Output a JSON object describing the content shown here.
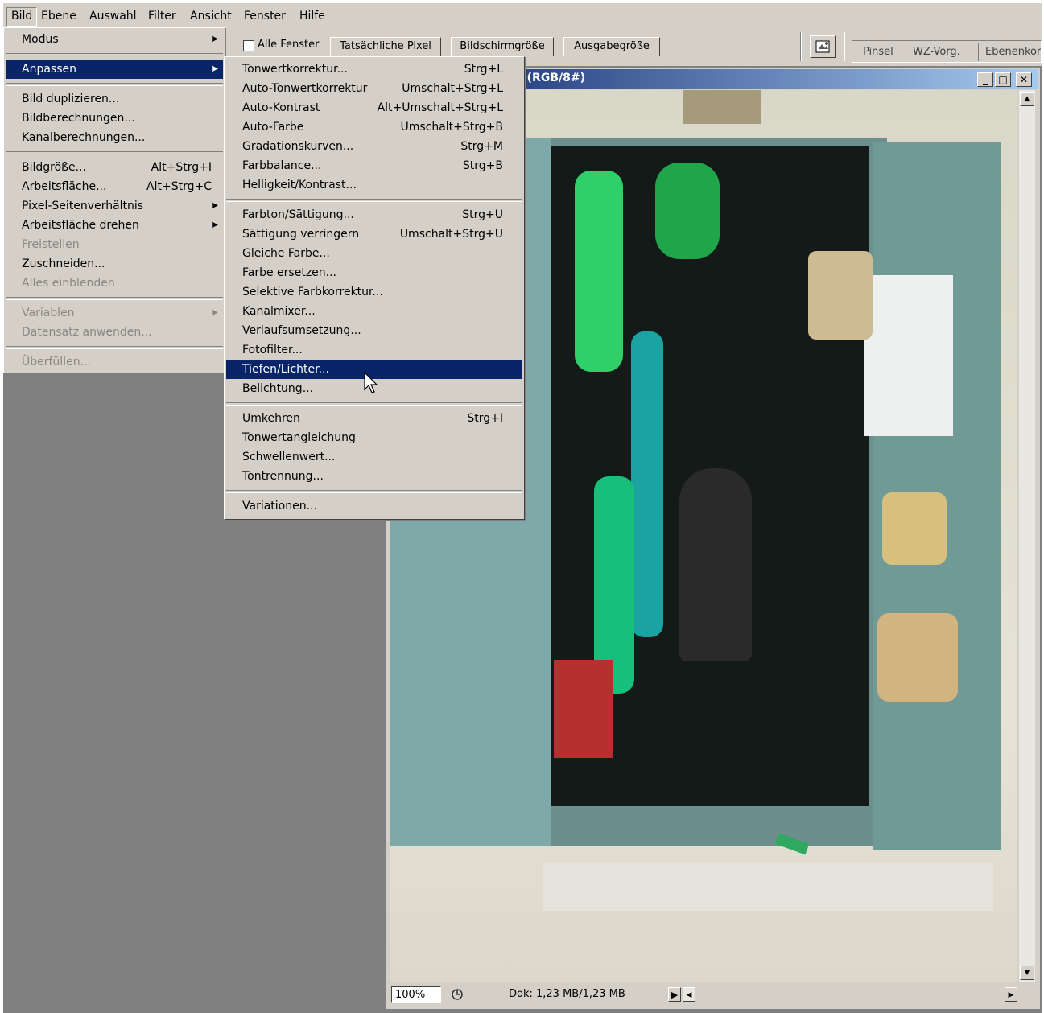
{
  "menubar": {
    "items": [
      "Bild",
      "Ebene",
      "Auswahl",
      "Filter",
      "Ansicht",
      "Fenster",
      "Hilfe"
    ]
  },
  "options": {
    "all_windows_label": "Alle Fenster",
    "actual_pixels": "Tatsächliche Pixel",
    "fit_screen": "Bildschirmgröße",
    "print_size": "Ausgabegröße"
  },
  "palette_tabs": [
    "Pinsel",
    "WZ-Vorg.",
    "Ebenenkor"
  ],
  "document": {
    "title_fragment": "› (RGB/8#)",
    "zoom": "100%",
    "doc_info": "Dok: 1,23 MB/1,23 MB"
  },
  "bild_menu": {
    "items": [
      {
        "label": "Modus",
        "submenu": true
      },
      {
        "label": "Anpassen",
        "submenu": true,
        "highlighted": true
      },
      {
        "label": "Bild duplizieren..."
      },
      {
        "label": "Bildberechnungen..."
      },
      {
        "label": "Kanalberechnungen..."
      },
      {
        "label": "Bildgröße...",
        "shortcut": "Alt+Strg+I"
      },
      {
        "label": "Arbeitsfläche...",
        "shortcut": "Alt+Strg+C"
      },
      {
        "label": "Pixel-Seitenverhältnis",
        "submenu": true
      },
      {
        "label": "Arbeitsfläche drehen",
        "submenu": true
      },
      {
        "label": "Freistellen",
        "disabled": true
      },
      {
        "label": "Zuschneiden..."
      },
      {
        "label": "Alles einblenden",
        "disabled": true
      },
      {
        "label": "Variablen",
        "submenu": true,
        "disabled": true
      },
      {
        "label": "Datensatz anwenden...",
        "disabled": true
      },
      {
        "label": "Überfüllen...",
        "disabled": true
      }
    ]
  },
  "anpassen_menu": {
    "items": [
      {
        "label": "Tonwertkorrektur...",
        "shortcut": "Strg+L"
      },
      {
        "label": "Auto-Tonwertkorrektur",
        "shortcut": "Umschalt+Strg+L"
      },
      {
        "label": "Auto-Kontrast",
        "shortcut": "Alt+Umschalt+Strg+L"
      },
      {
        "label": "Auto-Farbe",
        "shortcut": "Umschalt+Strg+B"
      },
      {
        "label": "Gradationskurven...",
        "shortcut": "Strg+M"
      },
      {
        "label": "Farbbalance...",
        "shortcut": "Strg+B"
      },
      {
        "label": "Helligkeit/Kontrast..."
      },
      {
        "label": "Farbton/Sättigung...",
        "shortcut": "Strg+U"
      },
      {
        "label": "Sättigung verringern",
        "shortcut": "Umschalt+Strg+U"
      },
      {
        "label": "Gleiche Farbe..."
      },
      {
        "label": "Farbe ersetzen..."
      },
      {
        "label": "Selektive Farbkorrektur..."
      },
      {
        "label": "Kanalmixer..."
      },
      {
        "label": "Verlaufsumsetzung..."
      },
      {
        "label": "Fotofilter..."
      },
      {
        "label": "Tiefen/Lichter...",
        "highlighted": true
      },
      {
        "label": "Belichtung..."
      },
      {
        "label": "Umkehren",
        "shortcut": "Strg+I"
      },
      {
        "label": "Tonwertangleichung"
      },
      {
        "label": "Schwellenwert..."
      },
      {
        "label": "Tontrennung..."
      },
      {
        "label": "Variationen..."
      }
    ]
  },
  "colors": {
    "menu_bg": "#d4d0c8",
    "highlight": "#0a246a",
    "workspace": "#808080"
  }
}
